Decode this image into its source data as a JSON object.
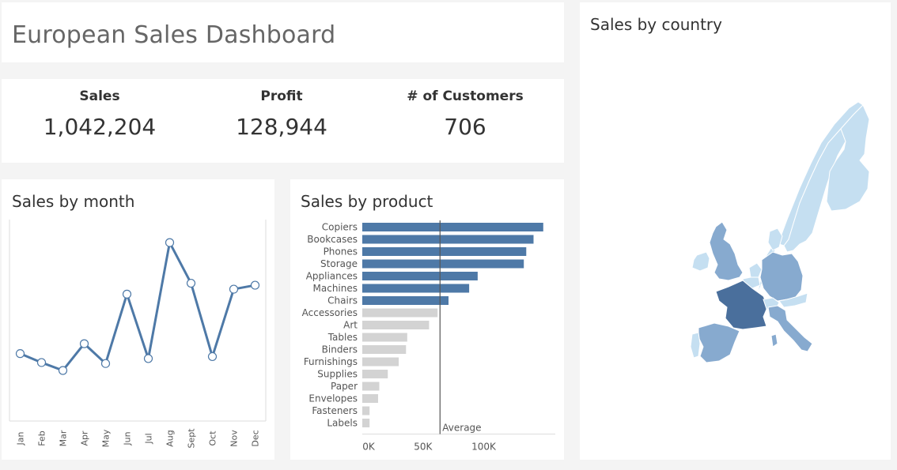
{
  "dashboard": {
    "title": "European Sales Dashboard"
  },
  "kpis": [
    {
      "label": "Sales",
      "value": "1,042,204"
    },
    {
      "label": "Profit",
      "value": "128,944"
    },
    {
      "label": "# of Customers",
      "value": "706"
    }
  ],
  "month_chart": {
    "title": "Sales by month"
  },
  "product_chart": {
    "title": "Sales by product",
    "reference_line_label": "Average"
  },
  "map_chart": {
    "title": "Sales by country"
  },
  "colors": {
    "above_average": "#4e79a7",
    "below_average": "#d3d3d3",
    "line": "#4e79a7",
    "reference_line": "#555555",
    "map_dark": "#4a6f9c",
    "map_mid": "#87aacf",
    "map_light": "#c5dff1"
  },
  "chart_data": [
    {
      "type": "line",
      "title": "Sales by month",
      "categories": [
        "Jan",
        "Feb",
        "Mar",
        "Apr",
        "May",
        "Jun",
        "Jul",
        "Aug",
        "Sept",
        "Oct",
        "Nov",
        "Dec"
      ],
      "values": [
        68000,
        59000,
        51000,
        78000,
        58000,
        128000,
        63000,
        180000,
        139000,
        65000,
        133000,
        137000
      ],
      "ylim": [
        0,
        200000
      ],
      "grid": false
    },
    {
      "type": "bar",
      "orientation": "horizontal",
      "title": "Sales by product",
      "categories": [
        "Copiers",
        "Bookcases",
        "Phones",
        "Storage",
        "Appliances",
        "Machines",
        "Chairs",
        "Accessories",
        "Art",
        "Tables",
        "Binders",
        "Furnishings",
        "Supplies",
        "Paper",
        "Envelopes",
        "Fasteners",
        "Labels"
      ],
      "values": [
        149000,
        141000,
        135000,
        133000,
        95000,
        88000,
        71000,
        62000,
        55000,
        37000,
        36000,
        30000,
        21000,
        14000,
        13000,
        6000,
        6000
      ],
      "xticks": [
        "0K",
        "50K",
        "100K"
      ],
      "xlim": [
        0,
        155000
      ],
      "reference_line": {
        "label": "Average",
        "value": 64000
      }
    },
    {
      "type": "map",
      "title": "Sales by country",
      "region": "Europe",
      "shading": {
        "France": "dark",
        "Germany": "mid",
        "United Kingdom": "mid",
        "Spain": "mid",
        "Italy": "mid",
        "Netherlands": "light",
        "Belgium": "light",
        "Austria": "light",
        "Switzerland": "light",
        "Ireland": "light",
        "Portugal": "light",
        "Denmark": "light",
        "Sweden": "light",
        "Norway": "light",
        "Finland": "light"
      }
    }
  ]
}
